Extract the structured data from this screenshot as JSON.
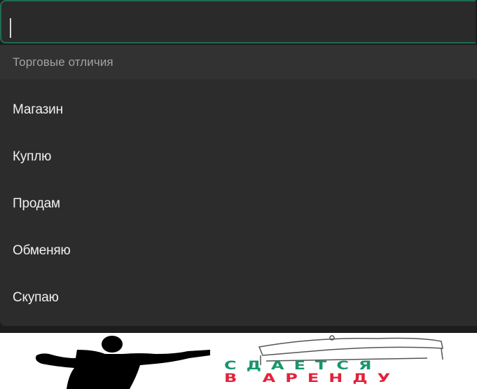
{
  "search": {
    "value": "",
    "placeholder": ""
  },
  "dropdown": {
    "group_label": "Торговые отличия",
    "options": [
      {
        "label": "Магазин"
      },
      {
        "label": "Куплю"
      },
      {
        "label": "Продам"
      },
      {
        "label": "Обменяю"
      },
      {
        "label": "Скупаю"
      }
    ]
  },
  "banner": {
    "line1": "СДАЕТСЯ",
    "line2": "В АРЕНДУ",
    "colors": {
      "line1": "#17956d",
      "line2": "#e0233a"
    }
  },
  "colors": {
    "background": "#2c2c2c",
    "input_border": "#1f6b52",
    "header_text": "#a3a3a3",
    "option_text": "#f0f0f0"
  }
}
